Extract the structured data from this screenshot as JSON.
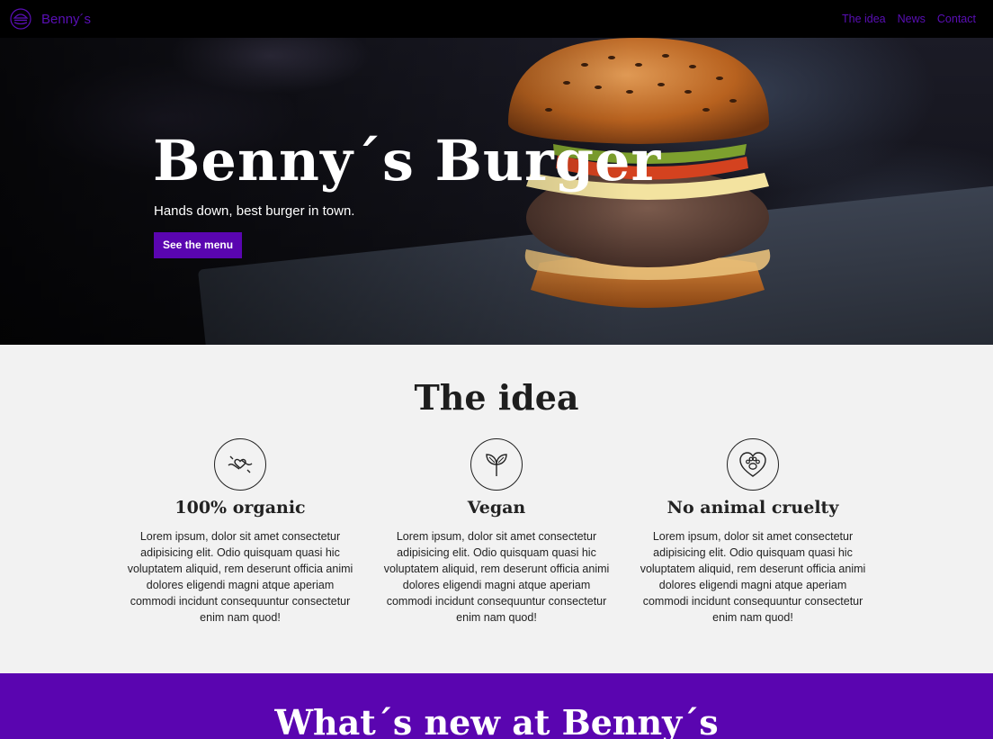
{
  "navbar": {
    "brand": "Benny´s",
    "logo_icon": "burger-icon",
    "links": [
      "The idea",
      "News",
      "Contact"
    ]
  },
  "hero": {
    "title": "Benny´s Burger",
    "subtitle": "Hands down, best burger in town.",
    "button": "See the menu"
  },
  "idea": {
    "title": "The idea",
    "features": [
      {
        "icon": "caring-hands-heart-icon",
        "title": "100% organic",
        "text": "Lorem ipsum, dolor sit amet consectetur adipisicing elit. Odio quisquam quasi hic voluptatem aliquid, rem deserunt officia animi dolores eligendi magni atque aperiam commodi incidunt consequuntur consectetur enim nam quod!"
      },
      {
        "icon": "sprout-icon",
        "title": "Vegan",
        "text": "Lorem ipsum, dolor sit amet consectetur adipisicing elit. Odio quisquam quasi hic voluptatem aliquid, rem deserunt officia animi dolores eligendi magni atque aperiam commodi incidunt consequuntur consectetur enim nam quod!"
      },
      {
        "icon": "heart-paw-icon",
        "title": "No animal cruelty",
        "text": "Lorem ipsum, dolor sit amet consectetur adipisicing elit. Odio quisquam quasi hic voluptatem aliquid, rem deserunt officia animi dolores eligendi magni atque aperiam commodi incidunt consequuntur consectetur enim nam quod!"
      }
    ]
  },
  "news": {
    "title": "What´s new at Benny´s"
  },
  "colors": {
    "accent": "#5a05b0",
    "nav_bg": "#000000",
    "section_bg": "#f2f2f2"
  }
}
